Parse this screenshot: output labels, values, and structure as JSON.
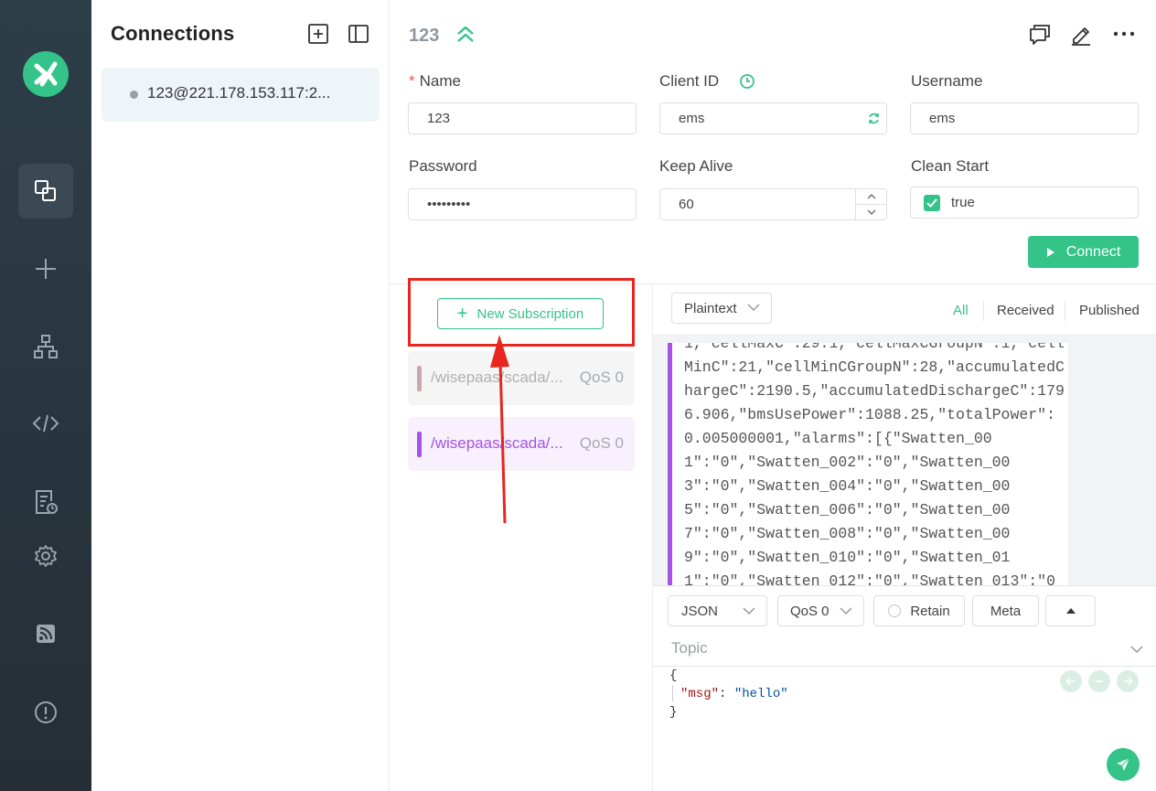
{
  "connections": {
    "title": "Connections",
    "items": [
      {
        "label": "123@221.178.153.117:2..."
      }
    ]
  },
  "header": {
    "title": "123"
  },
  "form": {
    "name_label": "Name",
    "name_value": "123",
    "client_id_label": "Client ID",
    "client_id_value": "ems",
    "username_label": "Username",
    "username_value": "ems",
    "password_label": "Password",
    "password_value": "•••••••••",
    "keep_alive_label": "Keep Alive",
    "keep_alive_value": "60",
    "clean_start_label": "Clean Start",
    "clean_start_value": "true",
    "connect_label": "Connect"
  },
  "subscriptions": {
    "new_label": "New Subscription",
    "items": [
      {
        "topic": "/wisepaas/scada/...",
        "qos": "QoS 0",
        "color": "#c7a9ad"
      },
      {
        "topic": "/wisepaas/scada/...",
        "qos": "QoS 0",
        "color": "#a453e6"
      }
    ]
  },
  "messages": {
    "format": "Plaintext",
    "filters": [
      "All",
      "Received",
      "Published"
    ],
    "payload": "1,\"cellMaxC\":29.1,\"cellMaxCGroupN\":1,\"cellMinC\":21,\"cellMinCGroupN\":28,\"accumulatedChargeC\":2190.5,\"accumulatedDischargeC\":1796.906,\"bmsUsePower\":1088.25,\"totalPower\":0.005000001,\"alarms\":[{\"Swatten_001\":\"0\",\"Swatten_002\":\"0\",\"Swatten_003\":\"0\",\"Swatten_004\":\"0\",\"Swatten_005\":\"0\",\"Swatten_006\":\"0\",\"Swatten_007\":\"0\",\"Swatten_008\":\"0\",\"Swatten_009\":\"0\",\"Swatten_010\":\"0\",\"Swatten_011\":\"0\",\"Swatten_012\":\"0\",\"Swatten_013\":\"0"
  },
  "composer": {
    "format": "JSON",
    "qos": "QoS 0",
    "retain_label": "Retain",
    "meta_label": "Meta",
    "topic_placeholder": "Topic",
    "line1": "{",
    "key": "\"msg\"",
    "colon": ": ",
    "value": "\"hello\"",
    "line3": "}"
  },
  "colors": {
    "accent": "#34c388",
    "sidebar": "#2d3e49",
    "highlight": "#e8261f"
  }
}
